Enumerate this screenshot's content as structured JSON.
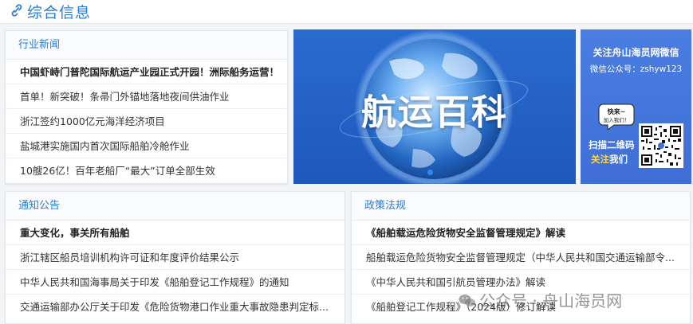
{
  "header": {
    "title": "综合信息",
    "icon": "link-icon",
    "accent": "#2a7bd9"
  },
  "industry_news": {
    "title": "行业新闻",
    "items": [
      "中国虾峙门普陀国际航运产业园正式开园！洲际船务运营！",
      "首单！新突破！条帚门外锚地落地夜间供油作业",
      "浙江签约1000亿元海洋经济项目",
      "盐城港实施国内首次国际船舶冷舱作业",
      "10艘26亿！百年老船厂“最大”订单全部生效"
    ]
  },
  "banner": {
    "text": "航运百科",
    "bg": "#2563c9"
  },
  "wechat_card": {
    "title": "关注舟山海员网微信",
    "subtitle": "微信公众号：zshyw123",
    "bubble_line1": "快来~",
    "bubble_line2": "加入我们！",
    "scan_line1": "扫描二维码",
    "scan_line2_highlight": "关注",
    "scan_line2_rest": "我们"
  },
  "notices": {
    "title": "通知公告",
    "items": [
      "重大变化，事关所有船舶",
      "浙江辖区船员培训机构许可证和年度评价结果公示",
      "中华人民共和国海事局关于印发《船舶登记工作规程》的通知",
      "交通运输部办公厅关于印发《危险货物港口作业重大事故隐患判定标..."
    ]
  },
  "policies": {
    "title": "政策法规",
    "items": [
      "《船舶载运危险货物安全监督管理规定》解读",
      "船舶载运危险货物安全监督管理规定（中华人民共和国交通运输部令...",
      "《中华人民共和国引航员管理办法》解读",
      "《船舶登记工作规程》（2024版）修订解读"
    ]
  },
  "watermark": {
    "text": "公众号 · 舟山海员网"
  }
}
